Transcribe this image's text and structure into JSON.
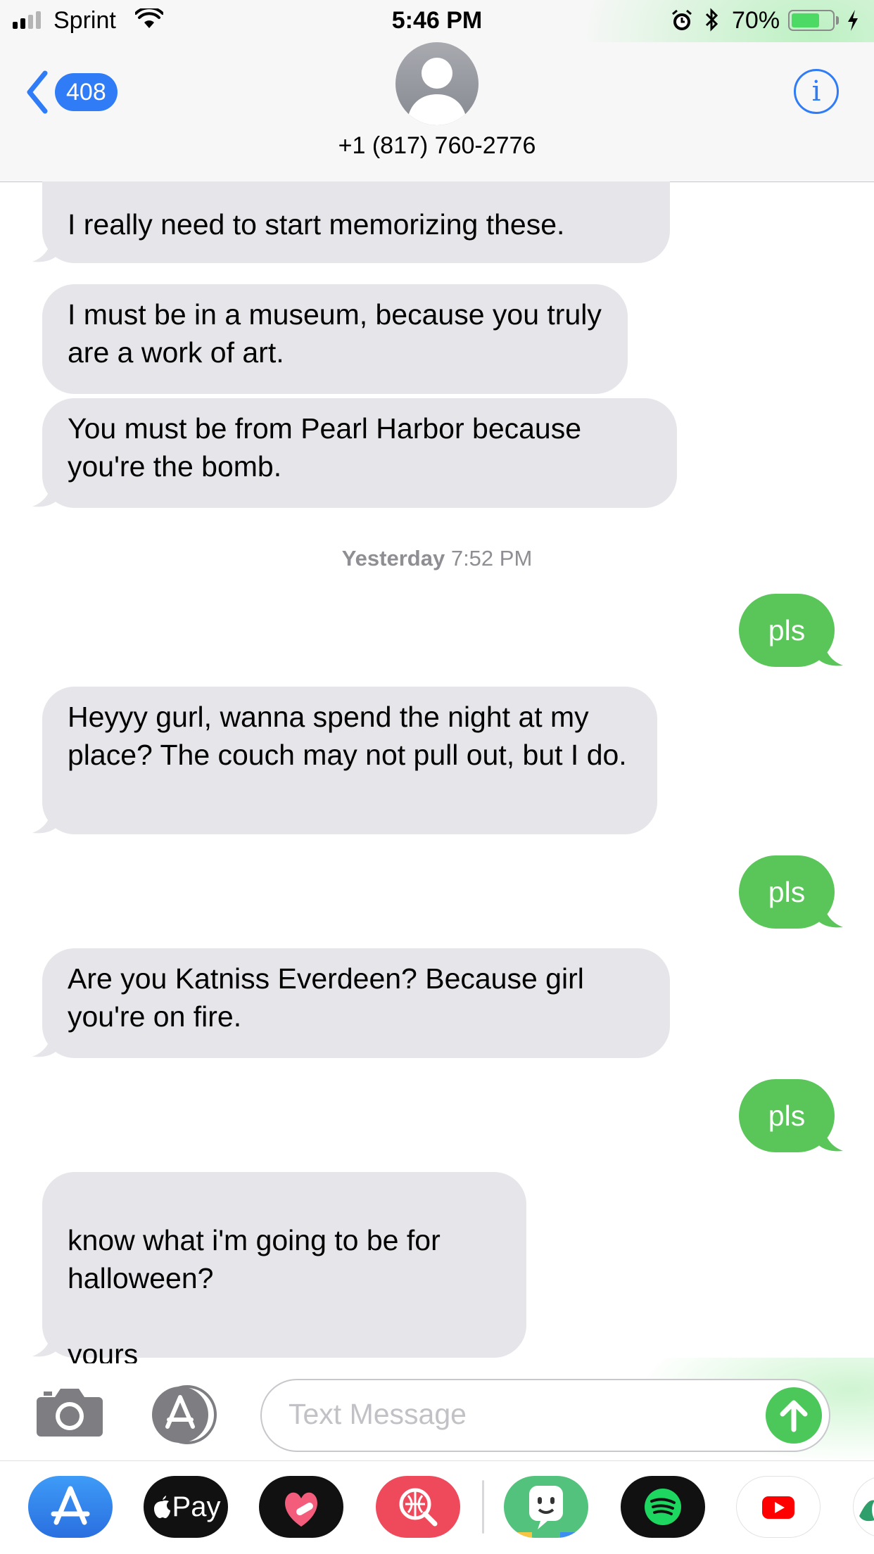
{
  "status_bar": {
    "carrier": "Sprint",
    "time": "5:46 PM",
    "battery_percent": "70%",
    "battery_level": 0.7,
    "signal_bars": 2
  },
  "header": {
    "back_count": "408",
    "contact": "+1 (817) 760-2776",
    "info_glyph": "i"
  },
  "timestamp": {
    "day": "Yesterday",
    "time": "7:52 PM"
  },
  "messages": [
    {
      "direction": "incoming",
      "text": "I really need to start memorizing these."
    },
    {
      "direction": "incoming",
      "text": "I must be in a museum, because you truly are a work of art."
    },
    {
      "direction": "incoming",
      "text": "You must be from Pearl Harbor because you're the bomb."
    },
    {
      "direction": "outgoing",
      "text": "pls"
    },
    {
      "direction": "incoming",
      "text": "Heyyy gurl, wanna spend the night at my place? The couch may not pull out, but I do."
    },
    {
      "direction": "outgoing",
      "text": "pls"
    },
    {
      "direction": "incoming",
      "text": "Are you Katniss Everdeen? Because girl you're on fire."
    },
    {
      "direction": "outgoing",
      "text": "pls"
    },
    {
      "direction": "incoming",
      "text": "know what i'm going to be for halloween?\n\nyours"
    }
  ],
  "composer": {
    "placeholder": "Text Message"
  },
  "app_drawer": [
    {
      "name": "app-store-icon",
      "label": ""
    },
    {
      "name": "apple-pay-icon",
      "label": "Pay"
    },
    {
      "name": "heart-sticker-icon",
      "label": ""
    },
    {
      "name": "web-search-icon",
      "label": ""
    },
    {
      "name": "bitmoji-icon",
      "label": ""
    },
    {
      "name": "spotify-icon",
      "label": ""
    },
    {
      "name": "youtube-icon",
      "label": ""
    },
    {
      "name": "partial-app-icon",
      "label": ""
    }
  ],
  "colors": {
    "incoming_bubble": "#e5e5ea",
    "outgoing_bubble": "#5ac65a",
    "accent_blue": "#2f7cf6"
  }
}
